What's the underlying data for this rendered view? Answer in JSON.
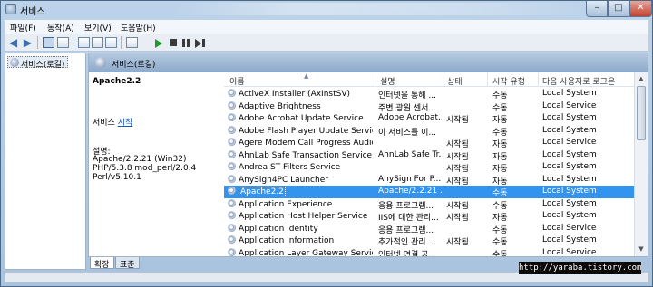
{
  "window": {
    "title": "서비스"
  },
  "menu": [
    {
      "label": "파일(F)"
    },
    {
      "label": "동작(A)"
    },
    {
      "label": "보기(V)"
    },
    {
      "label": "도움말(H)"
    }
  ],
  "tree": {
    "root_label": "서비스(로컬)"
  },
  "pane": {
    "header": "서비스(로컬)"
  },
  "detail": {
    "service_name": "Apache2.2",
    "start_prefix": "서비스 ",
    "start_link": "시작",
    "desc_label": "설명:",
    "desc_text": "Apache/2.2.21 (Win32) PHP/5.3.8 mod_perl/2.0.4 Perl/v5.10.1"
  },
  "list": {
    "columns": [
      {
        "label": "이름"
      },
      {
        "label": "설명"
      },
      {
        "label": "상태"
      },
      {
        "label": "시작 유형"
      },
      {
        "label": "다음 사용자로 로그온"
      }
    ],
    "rows": [
      {
        "name": "ActiveX Installer (AxInstSV)",
        "desc": "인터넷을 통해 ...",
        "state": "",
        "type": "수동",
        "logon": "Local System"
      },
      {
        "name": "Adaptive Brightness",
        "desc": "주변 광원 센서...",
        "state": "",
        "type": "수동",
        "logon": "Local Service"
      },
      {
        "name": "Adobe Acrobat Update Service",
        "desc": "Adobe Acrobat...",
        "state": "시작됨",
        "type": "자동",
        "logon": "Local System"
      },
      {
        "name": "Adobe Flash Player Update Service",
        "desc": "이 서비스를 이...",
        "state": "",
        "type": "수동",
        "logon": "Local System"
      },
      {
        "name": "Agere Modem Call Progress Audio",
        "desc": "",
        "state": "시작됨",
        "type": "자동",
        "logon": "Local Service"
      },
      {
        "name": "AhnLab Safe Transaction Service",
        "desc": "AhnLab Safe Tr...",
        "state": "시작됨",
        "type": "자동",
        "logon": "Local System"
      },
      {
        "name": "Andrea ST Filters Service",
        "desc": "",
        "state": "시작됨",
        "type": "자동",
        "logon": "Local System"
      },
      {
        "name": "AnySign4PC Launcher",
        "desc": "AnySign For P...",
        "state": "시작됨",
        "type": "자동",
        "logon": "Local System"
      },
      {
        "name": "Apache2.2",
        "desc": "Apache/2.2.21 ...",
        "state": "",
        "type": "수동",
        "logon": "Local System"
      },
      {
        "name": "Application Experience",
        "desc": "응용 프로그램...",
        "state": "시작됨",
        "type": "수동",
        "logon": "Local System"
      },
      {
        "name": "Application Host Helper Service",
        "desc": "IIS에 대한 관리...",
        "state": "시작됨",
        "type": "자동",
        "logon": "Local System"
      },
      {
        "name": "Application Identity",
        "desc": "응용 프로그램...",
        "state": "",
        "type": "수동",
        "logon": "Local Service"
      },
      {
        "name": "Application Information",
        "desc": "추가적인 관리 ...",
        "state": "시작됨",
        "type": "수동",
        "logon": "Local System"
      },
      {
        "name": "Application Layer Gateway Service",
        "desc": "인터넷 연결 공...",
        "state": "",
        "type": "수동",
        "logon": "Local Service"
      }
    ],
    "selected_index": 8
  },
  "tabs": [
    {
      "label": "확장"
    },
    {
      "label": "표준"
    }
  ],
  "watermark": "http://yaraba.tistory.com"
}
